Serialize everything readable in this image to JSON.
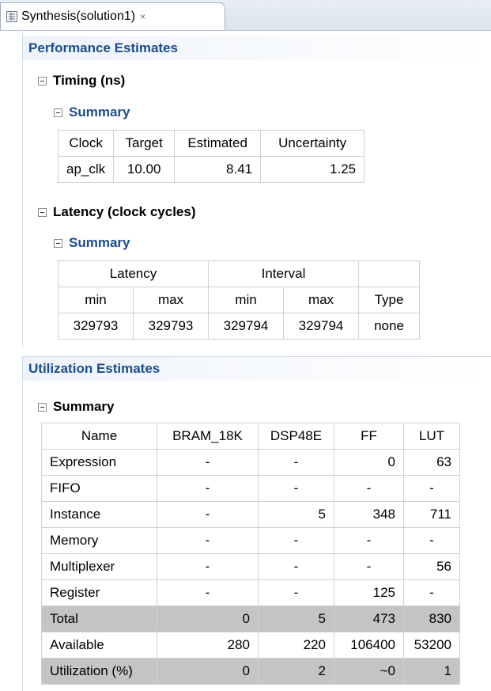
{
  "tab": {
    "title": "Synthesis(solution1)",
    "close_glyph": "×"
  },
  "performance": {
    "heading": "Performance Estimates",
    "timing": {
      "heading": "Timing (ns)",
      "summary_heading": "Summary",
      "columns": [
        "Clock",
        "Target",
        "Estimated",
        "Uncertainty"
      ],
      "rows": [
        [
          "ap_clk",
          "10.00",
          "8.41",
          "1.25"
        ]
      ]
    },
    "latency": {
      "heading": "Latency (clock cycles)",
      "summary_heading": "Summary",
      "group_headers": [
        "Latency",
        "Interval",
        ""
      ],
      "sub_headers": [
        "min",
        "max",
        "min",
        "max",
        "Type"
      ],
      "rows": [
        [
          "329793",
          "329793",
          "329794",
          "329794",
          "none"
        ]
      ]
    }
  },
  "utilization": {
    "heading": "Utilization Estimates",
    "summary_heading": "Summary",
    "columns": [
      "Name",
      "BRAM_18K",
      "DSP48E",
      "FF",
      "LUT"
    ],
    "rows": [
      [
        "Expression",
        "-",
        "-",
        "0",
        "63"
      ],
      [
        "FIFO",
        "-",
        "-",
        "-",
        "-"
      ],
      [
        "Instance",
        "-",
        "5",
        "348",
        "711"
      ],
      [
        "Memory",
        "-",
        "-",
        "-",
        "-"
      ],
      [
        "Multiplexer",
        "-",
        "-",
        "-",
        "56"
      ],
      [
        "Register",
        "-",
        "-",
        "125",
        "-"
      ],
      [
        "Total",
        "0",
        "5",
        "473",
        "830"
      ],
      [
        "Available",
        "280",
        "220",
        "106400",
        "53200"
      ],
      [
        "Utilization (%)",
        "0",
        "2",
        "~0",
        "1"
      ]
    ]
  }
}
